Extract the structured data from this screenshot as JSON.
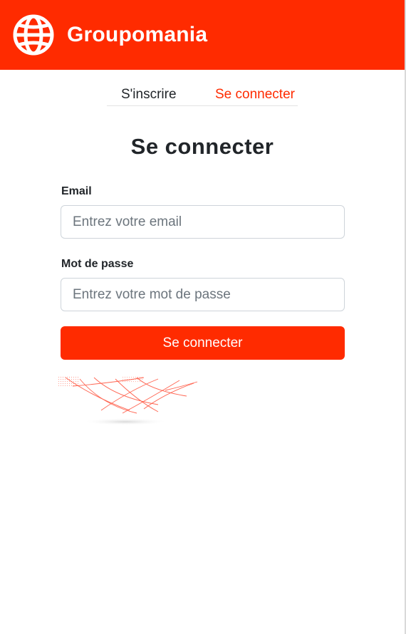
{
  "header": {
    "brand": "Groupomania",
    "logo_icon": "globe-icon",
    "background_color": "#ff2b00"
  },
  "tabs": {
    "signup_label": "S'inscrire",
    "login_label": "Se connecter",
    "active": "login"
  },
  "form": {
    "title": "Se connecter",
    "email_label": "Email",
    "email_placeholder": "Entrez votre email",
    "email_value": "",
    "password_label": "Mot de passe",
    "password_placeholder": "Entrez votre mot de passe",
    "password_value": "",
    "submit_label": "Se connecter"
  },
  "colors": {
    "accent": "#ff2b00",
    "text": "#212529",
    "placeholder": "#6c757d",
    "border": "#ced4da"
  }
}
